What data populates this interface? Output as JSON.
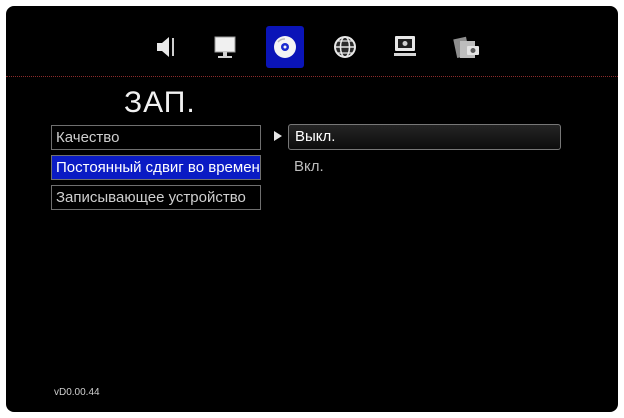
{
  "topbar": {
    "icons": [
      {
        "name": "audio-icon",
        "selected": false
      },
      {
        "name": "display-icon",
        "selected": false
      },
      {
        "name": "disc-record-icon",
        "selected": true
      },
      {
        "name": "network-globe-icon",
        "selected": false
      },
      {
        "name": "system-computer-icon",
        "selected": false
      },
      {
        "name": "media-photo-icon",
        "selected": false
      }
    ]
  },
  "page": {
    "title": "ЗАП."
  },
  "menu": {
    "items": [
      {
        "label": "Качество"
      },
      {
        "label": "Постоянный сдвиг во времени"
      },
      {
        "label": "Записывающее устройство"
      }
    ]
  },
  "options": {
    "items": [
      {
        "label": "Выкл."
      },
      {
        "label": "Вкл."
      }
    ]
  },
  "footer": {
    "version": "vD0.00.44"
  },
  "colors": {
    "background": "#000000",
    "accent": "#0a1bc4",
    "divider": "#8a2b2b"
  }
}
